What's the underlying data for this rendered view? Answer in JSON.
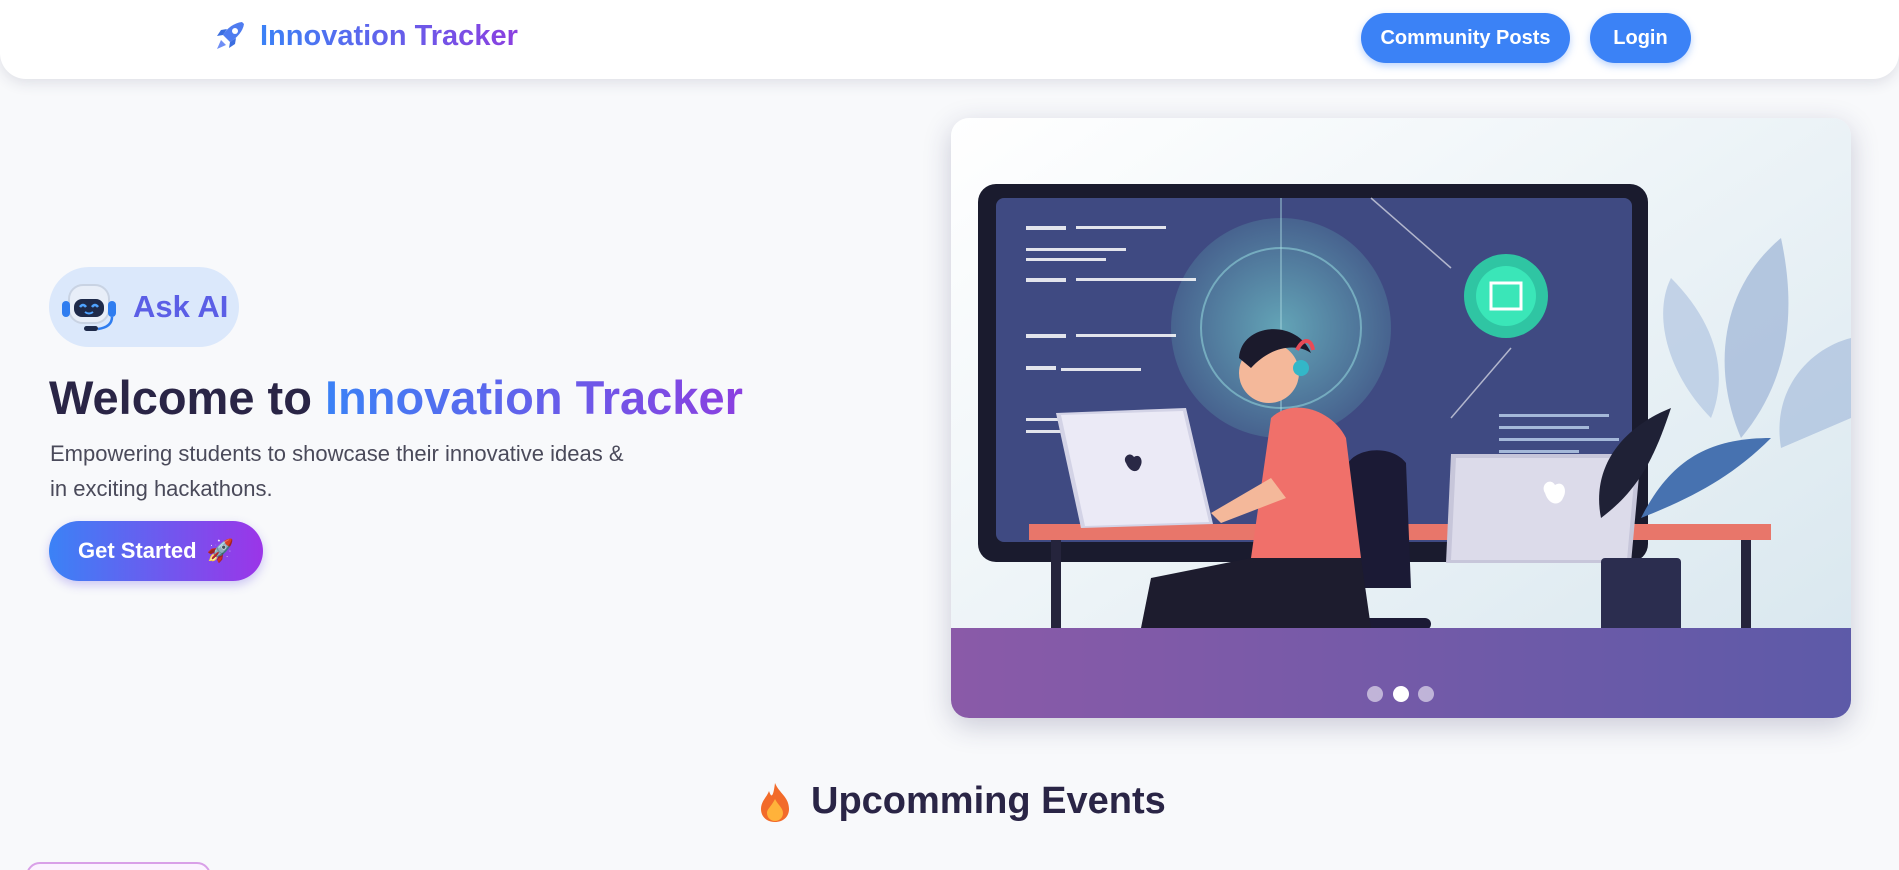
{
  "navbar": {
    "brand_title": "Innovation Tracker",
    "brand_icon": "rocket-icon",
    "community_label": "Community Posts",
    "login_label": "Login"
  },
  "hero": {
    "ask_ai_label": "Ask AI",
    "ask_ai_icon": "robot-icon",
    "title_prefix": "Welcome to ",
    "title_highlight": "Innovation Tracker",
    "subtitle_line1": "Empowering students to showcase their innovative ideas &",
    "subtitle_line2": "in exciting hackathons.",
    "cta_label": "Get Started",
    "cta_emoji": "🚀"
  },
  "carousel": {
    "slide_count": 3,
    "active_slide": 2,
    "image": "illustration of a developer working on a laptop in front of a large monitor"
  },
  "events": {
    "title": "Upcomming Events",
    "icon": "fire-icon"
  },
  "colors": {
    "accent_blue": "#3b82f6",
    "accent_purple": "#8b3fe0",
    "heading": "#2a2546",
    "background": "#f8f9fb"
  }
}
